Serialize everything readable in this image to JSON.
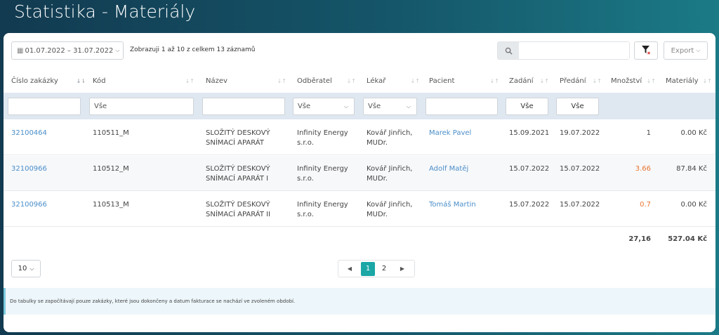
{
  "page": {
    "title": "Statistika - Materiály"
  },
  "toolbar": {
    "date_range": "01.07.2022 – 31.07.2022",
    "info": "Zobrazuji 1 až 10 z celkem 13 záznamů",
    "search_value": "",
    "export_label": "Export"
  },
  "table": {
    "headers": [
      "Číslo zakázky",
      "Kód",
      "Název",
      "Odběratel",
      "Lékař",
      "Pacient",
      "Zadání",
      "Předání",
      "Množství",
      "Materiály"
    ],
    "filters": {
      "kod": "Vše",
      "odberatel": "Vše",
      "lekar": "Vše",
      "zadani": "Vše",
      "predani": "Vše"
    },
    "rows": [
      {
        "cislo": "32100464",
        "kod": "110511_M",
        "nazev1": "SLOŽITÝ DESKOVÝ",
        "nazev2": "SNÍMACÍ APARÁT",
        "odberatel1": "Infinity Energy",
        "odberatel2": "s.r.o.",
        "lekar1": "Kovář Jinřich,",
        "lekar2": "MUDr.",
        "pacient": "Marek Pavel",
        "zadani": "15.09.2021",
        "predani": "19.07.2022",
        "mnozstvi": "1",
        "materialy": "0.00 Kč"
      },
      {
        "cislo": "32100966",
        "kod": "110512_M",
        "nazev1": "SLOŽITÝ DESKOVÝ",
        "nazev2": "SNÍMACÍ APARÁT I",
        "odberatel1": "Infinity Energy",
        "odberatel2": "s.r.o.",
        "lekar1": "Kovář Jinřich,",
        "lekar2": "MUDr.",
        "pacient": "Adolf Matěj",
        "zadani": "15.07.2022",
        "predani": "15.07.2022",
        "mnozstvi": "3.66",
        "materialy": "87.84 Kč"
      },
      {
        "cislo": "32100966",
        "kod": "110513_M",
        "nazev1": "SLOŽITÝ DESKOVÝ",
        "nazev2": "SNÍMACÍ APARÁT II",
        "odberatel1": "Infinity Energy",
        "odberatel2": "s.r.o.",
        "lekar1": "Kovář Jinřich,",
        "lekar2": "MUDr.",
        "pacient": "Tomáš Martin",
        "zadani": "15.07.2022",
        "predani": "15.07.2022",
        "mnozstvi": "0.7",
        "materialy": "0.00 Kč"
      }
    ],
    "totals": {
      "mnozstvi": "27,16",
      "materialy": "527.04 Kč"
    }
  },
  "footer": {
    "page_size": "10",
    "pages": [
      "1",
      "2"
    ],
    "current_page": "1",
    "note": "Do tabulky se započítávají pouze zakázky, které jsou dokončeny a datum fakturace se nachází ve zvoleném období."
  },
  "colors": {
    "accent": "#1ba7a6",
    "link": "#4a8ec9",
    "warning": "#e87530",
    "filter_row_bg": "#dfe7f1"
  },
  "icons": [
    "calendar-icon",
    "search-icon",
    "filter-clear-icon",
    "chevron-down-icon",
    "chevron-left-icon",
    "chevron-right-icon",
    "sort-icon"
  ]
}
